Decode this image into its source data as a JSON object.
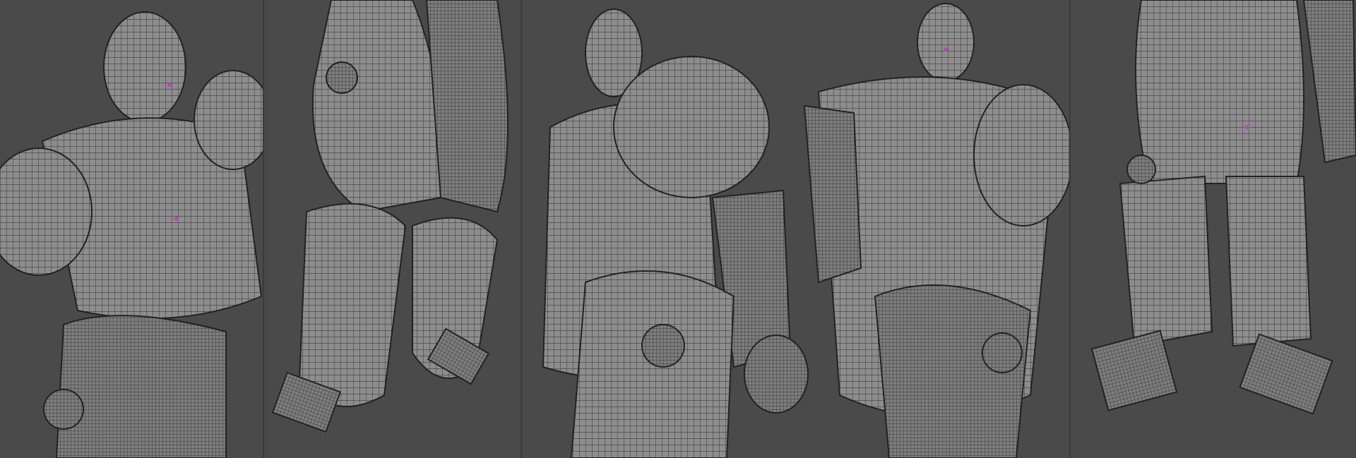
{
  "image": {
    "panels": [
      {
        "view": "front-three-quarter-torso"
      },
      {
        "view": "side-legs"
      },
      {
        "view": "side-and-back-full"
      },
      {
        "view": "back-legs"
      }
    ],
    "colors": {
      "background": "#4a4a4a",
      "surface": "#8e8e8e",
      "wire": "#2a2a2a",
      "highlight": "#c040c0"
    }
  }
}
